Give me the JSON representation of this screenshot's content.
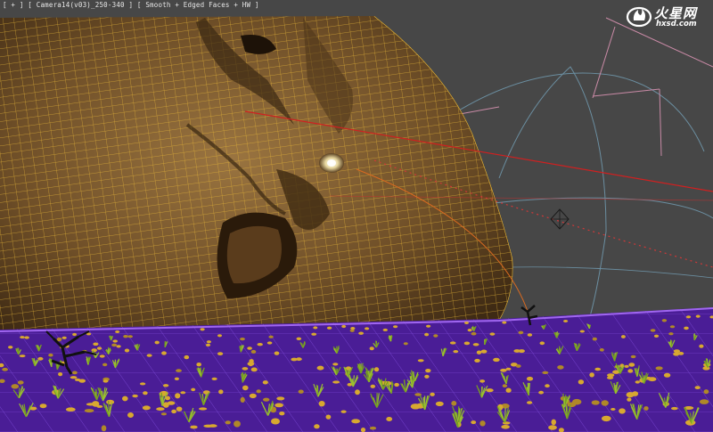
{
  "viewport": {
    "label_plus": "[ + ]",
    "label_camera": "[ Camera14(v03)_250-340 ]",
    "label_shading": "[ Smooth + Edged Faces + HW ]"
  },
  "watermark": {
    "title": "火星网",
    "url": "hxsd.com"
  },
  "colors": {
    "viewport_bg": "#474747",
    "mesh_fill": "#7a5a30",
    "wireframe": "#e0b030",
    "ground": "#6a2bc0",
    "ground_grid": "#8a55e0",
    "camera_lines": "#6b8ea0",
    "spline_red": "#d02020",
    "helper_pink": "#c98aa6",
    "grass": "#9ac030",
    "rocks": "#d8a830"
  }
}
